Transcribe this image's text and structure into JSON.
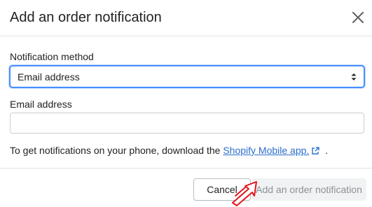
{
  "modal": {
    "title": "Add an order notification",
    "close_icon": "close-icon"
  },
  "form": {
    "method_label": "Notification method",
    "method_selected": "Email address",
    "method_arrows_icon": "select-arrows-icon",
    "email_label": "Email address",
    "email_value": "",
    "email_placeholder": ""
  },
  "note": {
    "prefix": "To get notifications on your phone, download the",
    "link_text": "Shopify Mobile app.",
    "link_icon": "external-link-icon",
    "suffix": "."
  },
  "footer": {
    "cancel_label": "Cancel",
    "primary_label": "Add an order notification"
  },
  "colors": {
    "focus_border": "#458fff",
    "link": "#2c6ecb",
    "disabled_bg": "#f1f2f3",
    "disabled_text": "#8c9196",
    "annotation_arrow": "#e3131b"
  }
}
